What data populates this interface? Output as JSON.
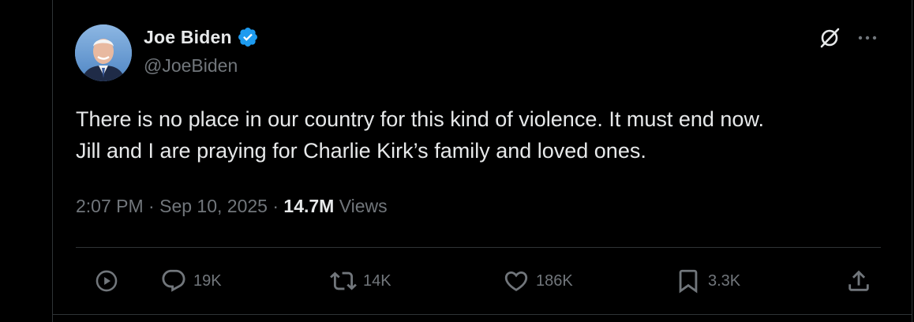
{
  "author": {
    "name": "Joe Biden",
    "handle": "@JoeBiden",
    "verified": true,
    "verified_color": "#1d9bf0"
  },
  "post": {
    "lines": [
      "There is no place in our country for this kind of violence. It must end now.",
      "Jill and I are praying for Charlie Kirk’s family and loved ones."
    ],
    "time": "2:07 PM",
    "date": "Sep 10, 2025",
    "separator": "·",
    "views_count": "14.7M",
    "views_label": "Views"
  },
  "actions": {
    "play": {
      "icon": "play-circle-icon"
    },
    "replies": {
      "icon": "reply-icon",
      "count": "19K"
    },
    "reposts": {
      "icon": "repost-icon",
      "count": "14K"
    },
    "likes": {
      "icon": "heart-icon",
      "count": "186K"
    },
    "bookmarks": {
      "icon": "bookmark-icon",
      "count": "3.3K"
    },
    "share": {
      "icon": "share-icon"
    }
  },
  "colors": {
    "background": "#000000",
    "text": "#e7e9ea",
    "muted": "#71767b",
    "divider": "#2f3336"
  }
}
